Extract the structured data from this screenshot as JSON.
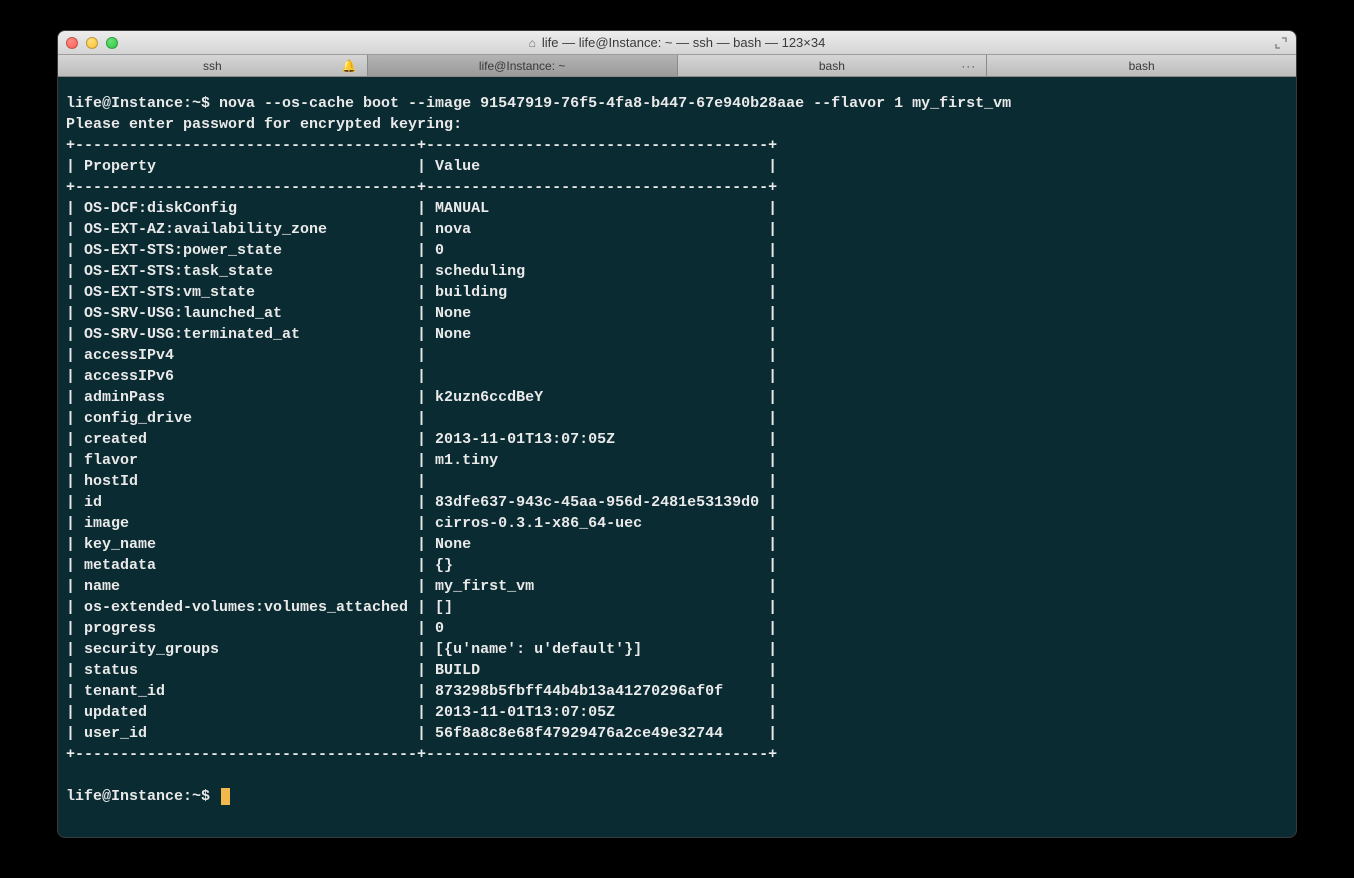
{
  "window": {
    "title": "life — life@Instance: ~ — ssh — bash — 123×34"
  },
  "tabs": [
    {
      "label": "ssh",
      "bell": true
    },
    {
      "label": "life@Instance: ~",
      "active": true
    },
    {
      "label": "bash",
      "ellipsis": true
    },
    {
      "label": "bash"
    }
  ],
  "prompt": "life@Instance:~$",
  "command": "nova --os-cache boot --image 91547919-76f5-4fa8-b447-67e940b28aae --flavor 1 my_first_vm",
  "keyring_msg": "Please enter password for encrypted keyring:",
  "table_header": {
    "col1": "Property",
    "col2": "Value"
  },
  "rows": [
    {
      "prop": "OS-DCF:diskConfig",
      "val": "MANUAL"
    },
    {
      "prop": "OS-EXT-AZ:availability_zone",
      "val": "nova"
    },
    {
      "prop": "OS-EXT-STS:power_state",
      "val": "0"
    },
    {
      "prop": "OS-EXT-STS:task_state",
      "val": "scheduling"
    },
    {
      "prop": "OS-EXT-STS:vm_state",
      "val": "building"
    },
    {
      "prop": "OS-SRV-USG:launched_at",
      "val": "None"
    },
    {
      "prop": "OS-SRV-USG:terminated_at",
      "val": "None"
    },
    {
      "prop": "accessIPv4",
      "val": ""
    },
    {
      "prop": "accessIPv6",
      "val": ""
    },
    {
      "prop": "adminPass",
      "val": "k2uzn6ccdBeY"
    },
    {
      "prop": "config_drive",
      "val": ""
    },
    {
      "prop": "created",
      "val": "2013-11-01T13:07:05Z"
    },
    {
      "prop": "flavor",
      "val": "m1.tiny"
    },
    {
      "prop": "hostId",
      "val": ""
    },
    {
      "prop": "id",
      "val": "83dfe637-943c-45aa-956d-2481e53139d0"
    },
    {
      "prop": "image",
      "val": "cirros-0.3.1-x86_64-uec"
    },
    {
      "prop": "key_name",
      "val": "None"
    },
    {
      "prop": "metadata",
      "val": "{}"
    },
    {
      "prop": "name",
      "val": "my_first_vm"
    },
    {
      "prop": "os-extended-volumes:volumes_attached",
      "val": "[]"
    },
    {
      "prop": "progress",
      "val": "0"
    },
    {
      "prop": "security_groups",
      "val": "[{u'name': u'default'}]"
    },
    {
      "prop": "status",
      "val": "BUILD"
    },
    {
      "prop": "tenant_id",
      "val": "873298b5fbff44b4b13a41270296af0f"
    },
    {
      "prop": "updated",
      "val": "2013-11-01T13:07:05Z"
    },
    {
      "prop": "user_id",
      "val": "56f8a8c8e68f47929476a2ce49e32744"
    }
  ],
  "col1_width": 38,
  "col2_width": 38
}
